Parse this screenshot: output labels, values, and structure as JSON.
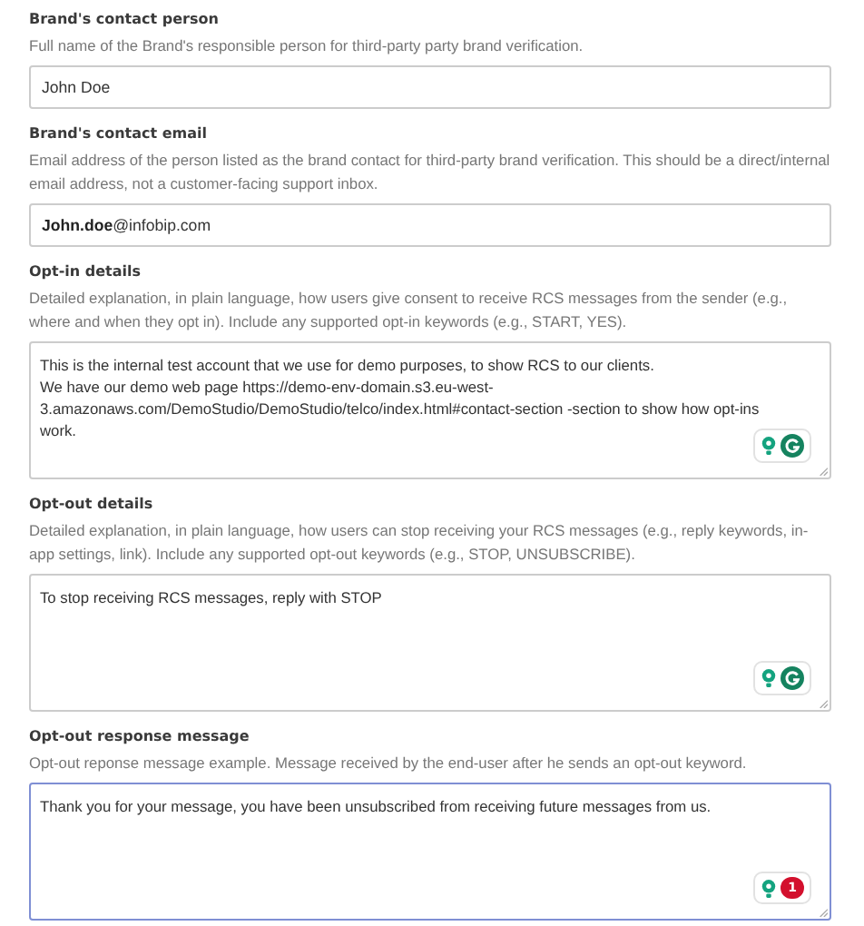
{
  "fields": [
    {
      "kind": "input",
      "label": "Brand's contact person",
      "description": "Full name of the Brand's responsible person for third-party party brand verification.",
      "value_lines": [
        "John Doe"
      ],
      "focused": false
    },
    {
      "kind": "input",
      "label": "Brand's contact email",
      "description": "Email address of the person listed as the brand contact for third-party brand verification. This should be a direct/internal email address, not a customer-facing support inbox.",
      "value_lines": [
        "**John.doe**@infobip.com"
      ],
      "focused": false
    },
    {
      "kind": "textarea",
      "label": "Opt-in details",
      "description": "Detailed explanation, in plain language, how users give consent to receive RCS messages from the sender (e.g., where and when they opt in). Include any supported opt-in keywords (e.g., START, YES).",
      "value_lines": [
        "This is the internal test account that we use for demo purposes, to show RCS to our clients.",
        "We have our demo web page https://demo-env-domain.s3.eu-west-",
        "3.amazonaws.com/DemoStudio/DemoStudio/telco/index.html#contact-section  -section to show how opt-ins",
        "work."
      ],
      "focused": false,
      "assistant": {
        "kind": "logo"
      }
    },
    {
      "kind": "textarea",
      "label": "Opt-out details",
      "description": "Detailed explanation, in plain language, how users can stop receiving your RCS messages (e.g., reply keywords, in-app settings, link). Include any supported opt-out keywords (e.g., STOP, UNSUBSCRIBE).",
      "value_lines": [
        "To stop receiving RCS messages, reply with STOP"
      ],
      "focused": false,
      "assistant": {
        "kind": "logo"
      }
    },
    {
      "kind": "textarea",
      "label": "Opt-out response message",
      "description": "Opt-out reponse message example. Message received by the end-user after he sends an opt-out keyword.",
      "value_lines": [
        "Thank you for your message, you have been unsubscribed from receiving future messages from us."
      ],
      "focused": true,
      "assistant": {
        "kind": "count",
        "issues": "1"
      }
    }
  ]
}
